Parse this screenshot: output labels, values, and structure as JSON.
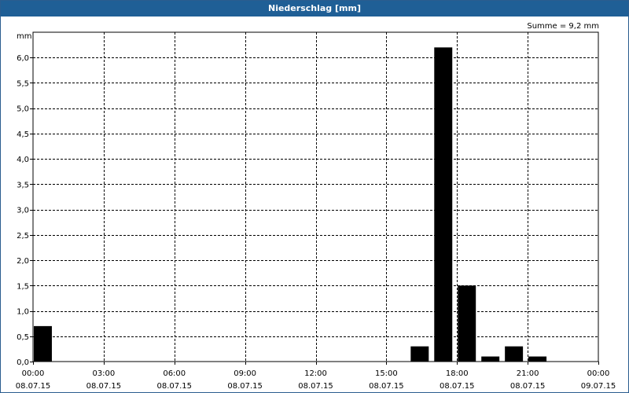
{
  "window": {
    "title": "Niederschlag [mm]"
  },
  "chart_data": {
    "type": "bar",
    "title": "Niederschlag [mm]",
    "ylabel": "mm",
    "summary": "Summe = 9,2 mm",
    "ylim": [
      0,
      6.5
    ],
    "y_ticks": [
      "0,0",
      "0,5",
      "1,0",
      "1,5",
      "2,0",
      "2,5",
      "3,0",
      "3,5",
      "4,0",
      "4,5",
      "5,0",
      "5,5",
      "6,0"
    ],
    "y_tick_values": [
      0,
      0.5,
      1,
      1.5,
      2,
      2.5,
      3,
      3.5,
      4,
      4.5,
      5,
      5.5,
      6
    ],
    "xlim_hours": [
      0,
      24
    ],
    "x_ticks": [
      {
        "time": "00:00",
        "date": "08.07.15",
        "hour": 0
      },
      {
        "time": "03:00",
        "date": "08.07.15",
        "hour": 3
      },
      {
        "time": "06:00",
        "date": "08.07.15",
        "hour": 6
      },
      {
        "time": "09:00",
        "date": "08.07.15",
        "hour": 9
      },
      {
        "time": "12:00",
        "date": "08.07.15",
        "hour": 12
      },
      {
        "time": "15:00",
        "date": "08.07.15",
        "hour": 15
      },
      {
        "time": "18:00",
        "date": "08.07.15",
        "hour": 18
      },
      {
        "time": "21:00",
        "date": "08.07.15",
        "hour": 21
      },
      {
        "time": "00:00",
        "date": "09.07.15",
        "hour": 24
      }
    ],
    "bars": [
      {
        "hour": 0,
        "value": 0.7
      },
      {
        "hour": 16,
        "value": 0.3
      },
      {
        "hour": 17,
        "value": 6.2
      },
      {
        "hour": 18,
        "value": 1.5
      },
      {
        "hour": 19,
        "value": 0.1
      },
      {
        "hour": 20,
        "value": 0.3
      },
      {
        "hour": 21,
        "value": 0.1
      }
    ],
    "bar_color": "#000000",
    "grid": true
  }
}
